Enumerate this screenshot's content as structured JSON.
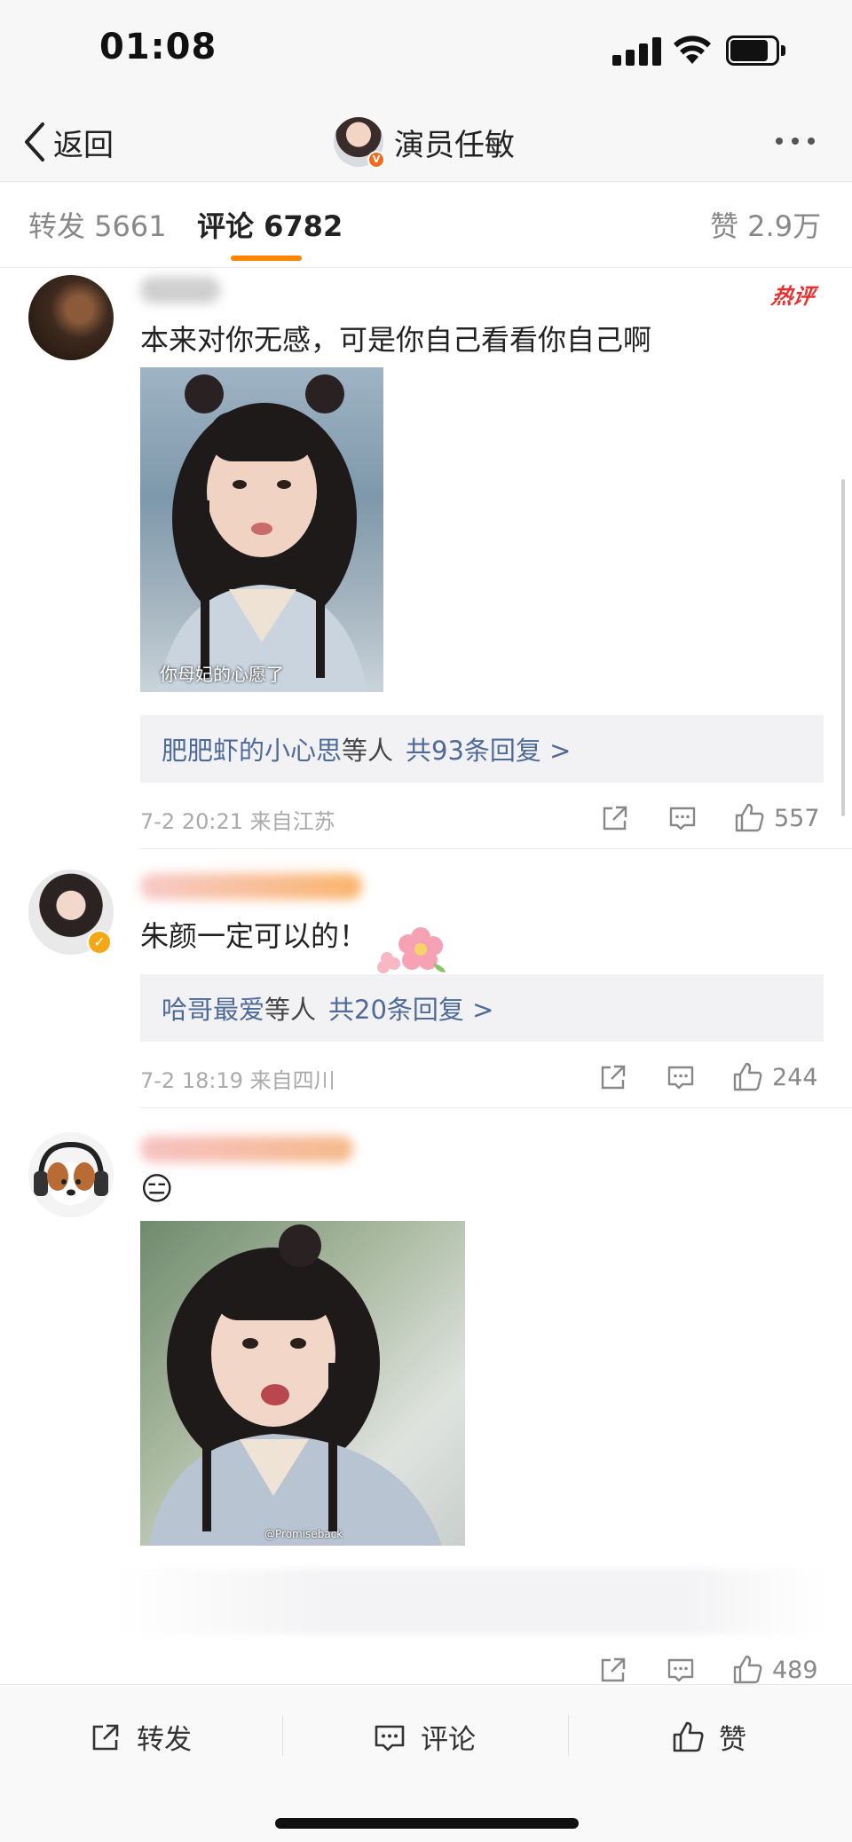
{
  "status_bar": {
    "time": "01:08"
  },
  "nav": {
    "back_label": "返回",
    "title": "演员任敏"
  },
  "tabs": {
    "repost": "转发 5661",
    "comments": "评论 6782",
    "likes": "赞 2.9万"
  },
  "comments": [
    {
      "badge": "热评",
      "text": "本来对你无感，可是你自己看看你自己啊",
      "image_caption": "你母妃的心愿了",
      "replies_who": "肥肥虾的小心思",
      "replies_and": "等人",
      "replies_count": "共93条回复 >",
      "time_location": "7-2 20:21 来自江苏",
      "likes": "557"
    },
    {
      "text": "朱颜一定可以的！",
      "replies_who": "哈哥最爱",
      "replies_and": "等人",
      "replies_count": "共20条回复 >",
      "time_location": "7-2 18:19 来自四川",
      "likes": "244"
    },
    {
      "text_emoji": "😑",
      "image_watermark": "@Promiseback",
      "likes": "489"
    }
  ],
  "bottom_bar": {
    "repost": "转发",
    "comment": "评论",
    "like": "赞"
  },
  "colors": {
    "accent": "#ff8200",
    "link": "#4e6a99",
    "hot": "#e8312f"
  }
}
